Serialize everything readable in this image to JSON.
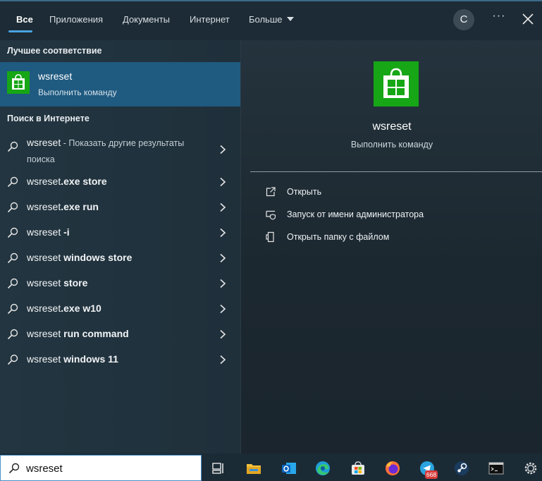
{
  "tabs": [
    {
      "label": "Все",
      "active": true
    },
    {
      "label": "Приложения"
    },
    {
      "label": "Документы"
    },
    {
      "label": "Интернет"
    },
    {
      "label": "Больше"
    }
  ],
  "account_initial": "С",
  "more_options": "···",
  "best_match": {
    "heading": "Лучшее соответствие",
    "title": "wsreset",
    "subtitle": "Выполнить команду",
    "icon": "store-icon"
  },
  "web": {
    "heading": "Поиск в Интернете",
    "first": {
      "query": "wsreset",
      "suffix": " - Показать другие результаты поиска"
    },
    "items": [
      {
        "prefix": "wsreset",
        "bold": ".exe store"
      },
      {
        "prefix": "wsreset",
        "bold": ".exe run"
      },
      {
        "prefix": "wsreset",
        "bold": " -i"
      },
      {
        "prefix": "wsreset",
        "bold": " windows store"
      },
      {
        "prefix": "wsreset",
        "bold": " store"
      },
      {
        "prefix": "wsreset",
        "bold": ".exe w10"
      },
      {
        "prefix": "wsreset",
        "bold": " run command"
      },
      {
        "prefix": "wsreset",
        "bold": " windows 11"
      }
    ]
  },
  "detail": {
    "title": "wsreset",
    "subtitle": "Выполнить команду",
    "actions": [
      {
        "label": "Открыть",
        "icon": "open-icon"
      },
      {
        "label": "Запуск от имени администратора",
        "icon": "shield-icon"
      },
      {
        "label": "Открыть папку с файлом",
        "icon": "file-folder-icon"
      }
    ]
  },
  "search": {
    "value": "wsreset"
  },
  "taskbar": {
    "telegram_badge": "668",
    "apps": [
      "task-view-icon",
      "file-explorer-icon",
      "outlook-icon",
      "edge-icon",
      "microsoft-store-icon",
      "firefox-icon",
      "telegram-icon",
      "steam-icon",
      "terminal-icon",
      "settings-icon"
    ]
  },
  "colors": {
    "accent": "#4aa3df",
    "selected_row": "#1f5a80",
    "store_green": "#16a616"
  }
}
